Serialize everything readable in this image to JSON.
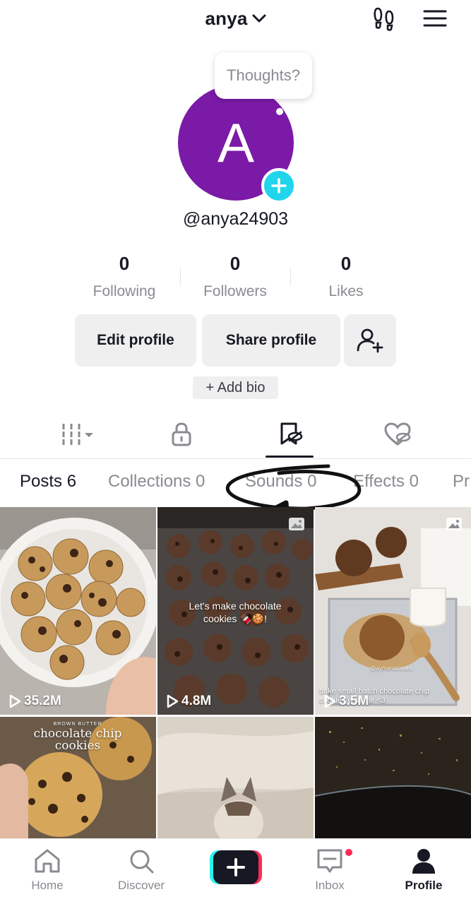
{
  "header": {
    "username_title": "anya"
  },
  "bubble": {
    "text": "Thoughts?"
  },
  "profile": {
    "avatar_letter": "A",
    "handle": "@anya24903"
  },
  "stats": [
    {
      "value": "0",
      "label": "Following"
    },
    {
      "value": "0",
      "label": "Followers"
    },
    {
      "value": "0",
      "label": "Likes"
    }
  ],
  "buttons": {
    "edit": "Edit profile",
    "share": "Share profile",
    "add_bio": "+ Add bio"
  },
  "subtabs": [
    "Posts 6",
    "Collections 0",
    "Sounds 0",
    "Effects 0",
    "Pr"
  ],
  "grid": [
    {
      "views": "35.2M",
      "caption": ""
    },
    {
      "views": "4.8M",
      "caption": "Let's make chocolate cookies 🍫🍪!"
    },
    {
      "views": "3.5M",
      "caption": "bake small batch chocolate chip cookies with me <3",
      "watermark": "@aymenaicooks"
    },
    {
      "views": "",
      "caption": "chocolate chip cookies",
      "small": "BROWN BUTTER"
    },
    {
      "views": "",
      "caption": ""
    },
    {
      "views": "",
      "caption": ""
    }
  ],
  "nav": {
    "home": "Home",
    "discover": "Discover",
    "inbox": "Inbox",
    "profile": "Profile"
  },
  "colors": {
    "avatar": "#7a1aa6",
    "accent_cyan": "#20d5ec",
    "accent_red": "#fe2c55"
  }
}
